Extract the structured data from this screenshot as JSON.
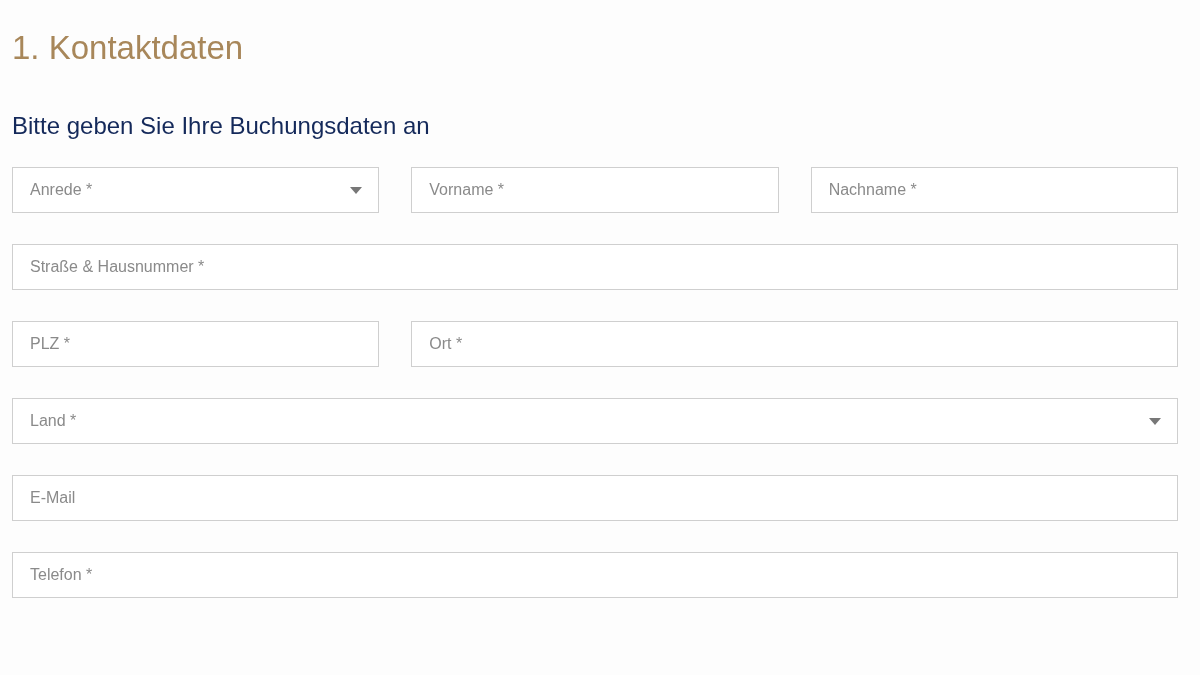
{
  "heading": "1. Kontaktdaten",
  "subheading": "Bitte geben Sie Ihre Buchungsdaten an",
  "rows": [
    [
      {
        "kind": "select",
        "placeholder": "Anrede *"
      },
      {
        "kind": "text",
        "placeholder": "Vorname *"
      },
      {
        "kind": "text",
        "placeholder": "Nachname *"
      }
    ],
    [
      {
        "kind": "text",
        "placeholder": "Straße & Hausnummer *"
      }
    ],
    [
      {
        "kind": "text",
        "placeholder": "PLZ *"
      },
      {
        "kind": "text",
        "placeholder": "Ort *"
      }
    ],
    [
      {
        "kind": "select",
        "placeholder": "Land *"
      }
    ],
    [
      {
        "kind": "text",
        "placeholder": "E-Mail"
      }
    ],
    [
      {
        "kind": "text",
        "placeholder": "Telefon *"
      }
    ]
  ]
}
